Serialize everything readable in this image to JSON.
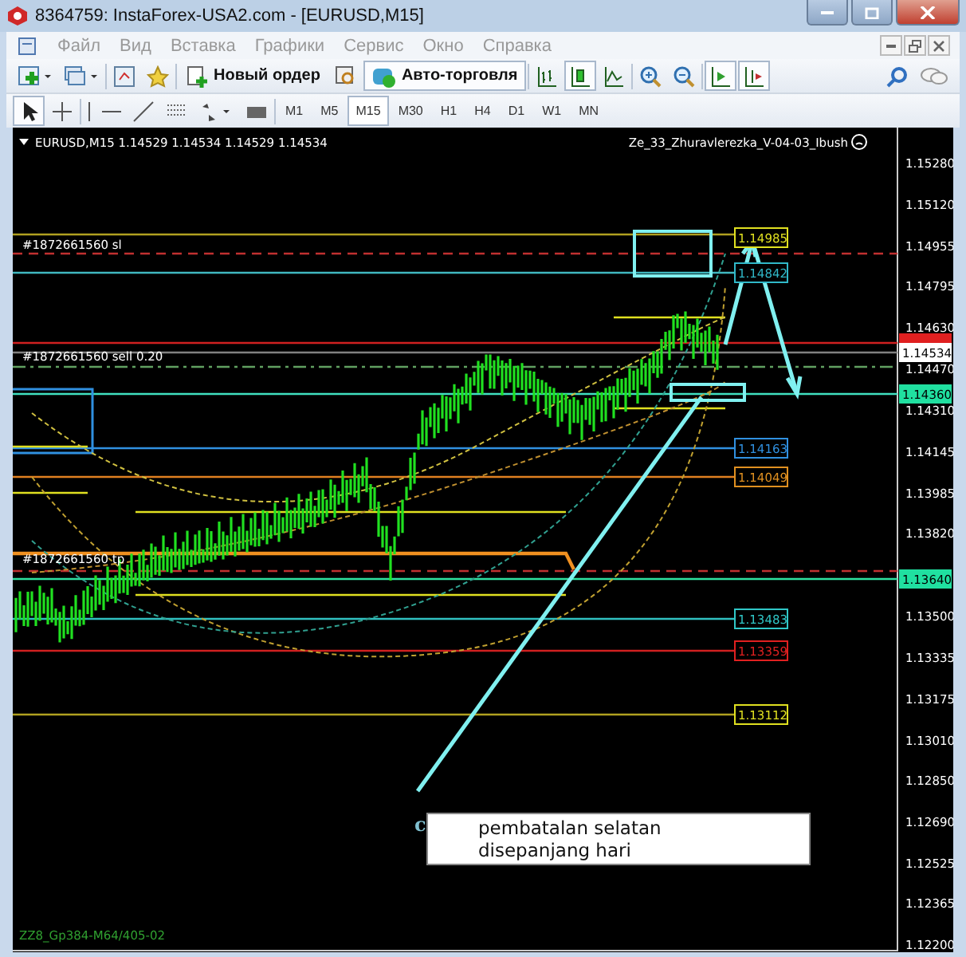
{
  "window": {
    "title": "8364759: InstaForex-USA2.com - [EURUSD,M15]"
  },
  "menu": [
    "Файл",
    "Вид",
    "Вставка",
    "Графики",
    "Сервис",
    "Окно",
    "Справка"
  ],
  "toolbar": {
    "new_order": "Новый ордер",
    "auto_trading": "Авто-торговля"
  },
  "timeframes": [
    {
      "label": "M1",
      "selected": false
    },
    {
      "label": "M5",
      "selected": false
    },
    {
      "label": "M15",
      "selected": true
    },
    {
      "label": "M30",
      "selected": false
    },
    {
      "label": "H1",
      "selected": false
    },
    {
      "label": "H4",
      "selected": false
    },
    {
      "label": "D1",
      "selected": false
    },
    {
      "label": "W1",
      "selected": false
    },
    {
      "label": "MN",
      "selected": false
    }
  ],
  "chart": {
    "symbol_info": "EURUSD,M15  1.14529 1.14534 1.14529 1.14534",
    "indicator_name": "Ze_33_Zhuravlerezka_V-04-03_Ibush",
    "bottom_label": "ZZ8_Gp384-M64/405-02",
    "order_labels": [
      "#1872661560 sl",
      "#1872661560 sell 0.20",
      "#1872661560 tp"
    ],
    "price_axis": [
      "1.15280",
      "1.15120",
      "1.14955",
      "1.14795",
      "1.14630",
      "1.14470",
      "1.14310",
      "1.14145",
      "1.13985",
      "1.13820",
      "1.13500",
      "1.13335",
      "1.13175",
      "1.13010",
      "1.12850",
      "1.12690",
      "1.12525",
      "1.12365",
      "1.12200"
    ],
    "price_tags": [
      {
        "text": "1.14534",
        "color": "#ffffff"
      },
      {
        "text": "1.14360",
        "color": "#20e0a0"
      },
      {
        "text": "1.13640",
        "color": "#20e0a0"
      }
    ],
    "level_labels": [
      {
        "text": "1.14985",
        "color": "#e0e020"
      },
      {
        "text": "1.14842",
        "color": "#30b8c8"
      },
      {
        "text": "1.14163",
        "color": "#3090e0"
      },
      {
        "text": "1.14049",
        "color": "#e09020"
      },
      {
        "text": "1.13483",
        "color": "#30c8c8"
      },
      {
        "text": "1.13359",
        "color": "#e02020"
      },
      {
        "text": "1.13112",
        "color": "#e0e020"
      }
    ],
    "note": {
      "marker": "c",
      "lines": [
        "pembatalan selatan",
        "disepanjang hari"
      ]
    }
  }
}
